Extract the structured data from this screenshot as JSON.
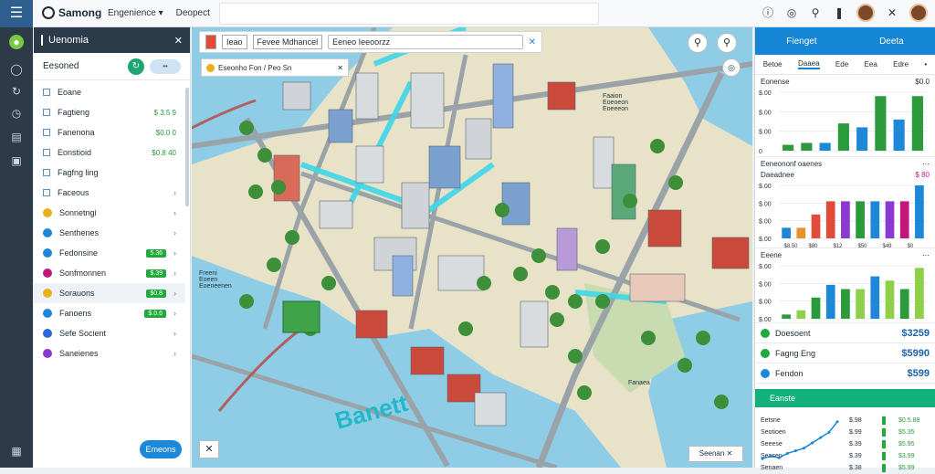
{
  "topbar": {
    "app_name": "Samong",
    "nav": [
      "Engenience ▾",
      "Deopect"
    ]
  },
  "left_panel": {
    "title": "Uenomia",
    "subtitle": "Eesoned",
    "items": [
      {
        "kind": "checkbox",
        "label": "Eoane",
        "value": ""
      },
      {
        "kind": "checkbox",
        "label": "Fagtieng",
        "value": "$ 3.5 9"
      },
      {
        "kind": "checkbox",
        "label": "Fanenona",
        "value": "$0.0 0"
      },
      {
        "kind": "checkbox",
        "label": "Eonstioid",
        "value": "$0.8 40"
      },
      {
        "kind": "checkbox",
        "label": "Fagfng ling",
        "value": ""
      },
      {
        "kind": "checkbox",
        "label": "Faceous",
        "value": ""
      },
      {
        "kind": "dot",
        "color": "#e9b21b",
        "label": "Sonnetngi",
        "value": ""
      },
      {
        "kind": "dot",
        "color": "#1e88d8",
        "label": "Senthenes",
        "value": ""
      },
      {
        "kind": "dot",
        "color": "#1e88d8",
        "label": "Fedonsine",
        "value": "5.36"
      },
      {
        "kind": "dot",
        "color": "#c2187e",
        "label": "Sonfmonnen",
        "value": "$.39"
      },
      {
        "kind": "dot",
        "color": "#e9b21b",
        "label": "Sorauons",
        "value": "$0.8"
      },
      {
        "kind": "dot",
        "color": "#1e88d8",
        "label": "Fanoens",
        "value": "$.0.6"
      },
      {
        "kind": "dot",
        "color": "#2a6ad8",
        "label": "Sefe Socient",
        "value": ""
      },
      {
        "kind": "dot",
        "color": "#8a3ad0",
        "label": "Saneienes",
        "value": ""
      }
    ],
    "bottom_button": "Emeons"
  },
  "map": {
    "bar_tab1": "Ieao",
    "bar_tab2": "Fevee Mdhancel",
    "search_text": "Eeneo Ieeoorzz",
    "chip": "Eseonho Fon / Peo Sn",
    "labels": [
      {
        "id": "lbl-a",
        "text": "Faaion\nEoeoeon\nEoeeeon"
      },
      {
        "id": "lbl-b",
        "text": "Freeni\nEoeen\nEoeneenen"
      },
      {
        "id": "lbl-c",
        "text": "Fanaea"
      }
    ],
    "water_label": "Banett",
    "bottom_right": "Seenan ✕",
    "colors": {
      "water": "#8fcde6",
      "land": "#e8e2c8",
      "road": "#9aa3a8",
      "highlight": "#3fd6e8",
      "tree": "#3d8f3a"
    }
  },
  "right_panel": {
    "header": [
      "Fienget",
      "Deeta"
    ],
    "tabs": [
      "Betoe",
      "Daaea",
      "Ede",
      "Eea",
      "Edre",
      "•"
    ],
    "chart1": {
      "title": "Eonense",
      "title_right": "$0.0"
    },
    "chart2": {
      "title": "Eeneononf oaenes",
      "subtitle": "Daeadnee",
      "subtitle_right": "$ 80"
    },
    "chart3": {
      "title": "Eeene"
    },
    "kpis": [
      {
        "label": "Doesoent",
        "value": "$3259",
        "color": "#1faa3a"
      },
      {
        "label": "Fagng Eng",
        "value": "$5990",
        "color": "#1faa3a"
      },
      {
        "label": "Fendon",
        "value": "$599",
        "color": "#1e88d8"
      }
    ],
    "table_title": "Eanste",
    "table": [
      {
        "name": "Eetsne",
        "a": "$.98",
        "b": "$0.5.88"
      },
      {
        "name": "Seotioen",
        "a": "$.99",
        "b": "$5.35"
      },
      {
        "name": "Seeese",
        "a": "$.39",
        "b": "$5.95"
      },
      {
        "name": "Seasen",
        "a": "$.39",
        "b": "$3.99"
      },
      {
        "name": "Senaen",
        "a": "$.38",
        "b": "$5.99"
      }
    ]
  },
  "chart_data": [
    {
      "type": "bar",
      "title": "Eonense",
      "yticks": [
        "$.00",
        "$.00",
        "$.00",
        "0"
      ],
      "categories": [
        "c1",
        "c2",
        "c3",
        "c4",
        "c5",
        "c6",
        "c7",
        "c8"
      ],
      "values": [
        3,
        4,
        4,
        14,
        12,
        28,
        16,
        28
      ],
      "colors": [
        "#2a9a3a",
        "#2a9a3a",
        "#1e88d8",
        "#2a9a3a",
        "#1e88d8",
        "#2a9a3a",
        "#1e88d8",
        "#2a9a3a"
      ],
      "ylim": [
        0,
        30
      ]
    },
    {
      "type": "bar",
      "title": "Eeneononf oaenes",
      "yticks": [
        "$.00",
        "$.00",
        "$.00",
        "$.00"
      ],
      "xticks": [
        "$8.50",
        "$80",
        "$12",
        "$50",
        "$49",
        "$0"
      ],
      "categories": [
        "c1",
        "c2",
        "c3",
        "c4",
        "c5",
        "c6",
        "c7",
        "c8",
        "c9",
        "c10"
      ],
      "values": [
        4,
        4,
        9,
        14,
        14,
        14,
        14,
        14,
        14,
        20
      ],
      "colors": [
        "#1e88d8",
        "#e8902a",
        "#e24a3a",
        "#e24a3a",
        "#8a3ad0",
        "#2a9a3a",
        "#1e88d8",
        "#8a3ad0",
        "#c2187e",
        "#1e88d8"
      ],
      "ylim": [
        0,
        20
      ]
    },
    {
      "type": "bar",
      "title": "Eeene",
      "yticks": [
        "$.00",
        "$.00",
        "$.00",
        "$.00"
      ],
      "categories": [
        "c1",
        "c2",
        "c3",
        "c4",
        "c5",
        "c6",
        "c7",
        "c8",
        "c9",
        "c10"
      ],
      "values": [
        2,
        4,
        10,
        16,
        14,
        14,
        20,
        18,
        14,
        24
      ],
      "colors": [
        "#2a9a3a",
        "#8fd04a",
        "#2a9a3a",
        "#1e88d8",
        "#2a9a3a",
        "#8fd04a",
        "#1e88d8",
        "#8fd04a",
        "#2a9a3a",
        "#8fd04a"
      ],
      "ylim": [
        0,
        25
      ]
    },
    {
      "type": "line",
      "title": "Eanste",
      "x": [
        0,
        1,
        2,
        3,
        4,
        5,
        6,
        7,
        8,
        9
      ],
      "values": [
        1,
        1.5,
        1.2,
        2,
        2.5,
        3,
        4,
        5,
        6,
        8
      ],
      "ylim": [
        0,
        9
      ]
    }
  ]
}
